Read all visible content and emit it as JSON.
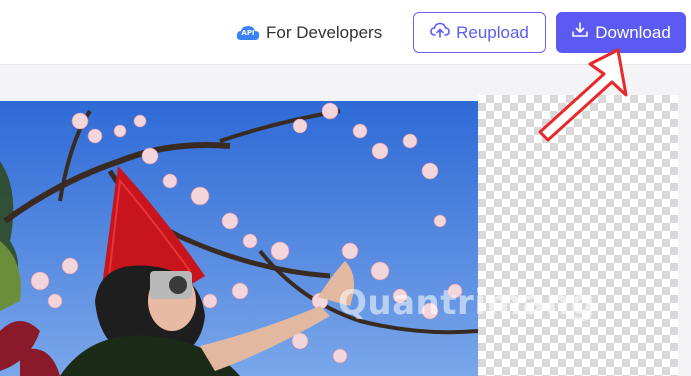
{
  "header": {
    "api_badge": "API",
    "for_developers": "For Developers",
    "reupload_label": "Reupload",
    "download_label": "Download"
  },
  "watermark": "Quantrimang",
  "colors": {
    "accent": "#5b5bf3",
    "arrow": "#e8282b"
  },
  "icons": [
    "api-badge-icon",
    "cloud-upload-icon",
    "download-icon"
  ]
}
